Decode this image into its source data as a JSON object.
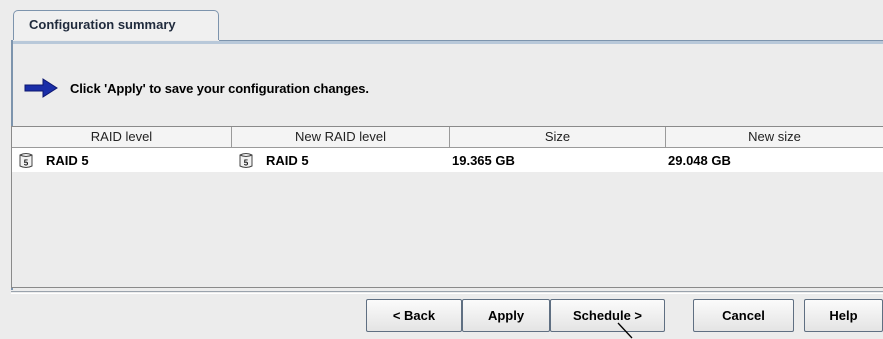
{
  "tab": {
    "label": "Configuration summary"
  },
  "message": {
    "text": "Click 'Apply' to save your configuration changes.",
    "icon": "arrow-right-icon",
    "icon_color": "#1a2ea8"
  },
  "table": {
    "columns": [
      "RAID level",
      "New RAID level",
      "Size",
      "New size"
    ],
    "rows": [
      {
        "raid_level": "RAID 5",
        "new_raid_level": "RAID 5",
        "size": "19.365 GB",
        "new_size": "29.048 GB",
        "icon": "disk-raid5-icon",
        "icon_text": "5"
      }
    ]
  },
  "buttons": {
    "back": "< Back",
    "apply": "Apply",
    "schedule": "Schedule >",
    "cancel": "Cancel",
    "help": "Help"
  }
}
